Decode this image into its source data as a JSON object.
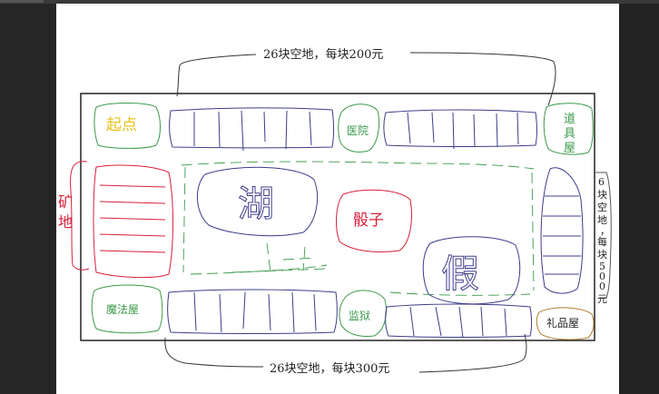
{
  "labels": {
    "top_note": "26块空地，每块200元",
    "bottom_note": "26块空地，每块300元",
    "start": "起点",
    "hospital": "医院",
    "tool_house": [
      "道",
      "具",
      "屋"
    ],
    "mine": [
      "矿",
      "地"
    ],
    "lake": "湖",
    "dice": "骰子",
    "fake": "假",
    "magic_house": "魔法屋",
    "prison": "监狱",
    "gift_house": "礼品屋",
    "right_note": [
      "6",
      "块",
      "空",
      "地",
      "，",
      "每",
      "块",
      "5",
      "0",
      "0",
      "元"
    ]
  },
  "colors": {
    "board": "#000000",
    "blue": "#3c3c8c",
    "green": "#3a9a4a",
    "red": "#d8203a",
    "yellow": "#e8c21a",
    "brown": "#b07a2a",
    "gray": "#777777"
  }
}
